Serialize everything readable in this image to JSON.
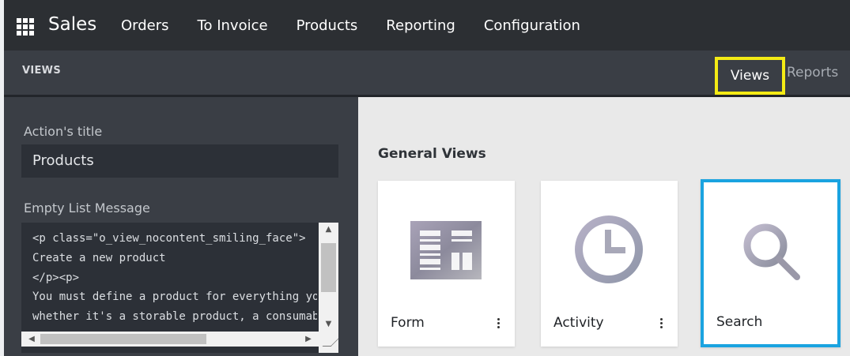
{
  "navbar": {
    "app_name": "Sales",
    "menu": [
      "Orders",
      "To Invoice",
      "Products",
      "Reporting",
      "Configuration"
    ]
  },
  "subbar": {
    "title": "VIEWS",
    "tabs": {
      "views": "Views",
      "reports": "Reports"
    }
  },
  "sidebar": {
    "action_title_label": "Action's title",
    "action_title_value": "Products",
    "empty_list_label": "Empty List Message",
    "empty_list_value": "<p class=\"o_view_nocontent_smiling_face\">\nCreate a new product\n</p><p>\nYou must define a product for everything you sell or purchase,\nwhether it's a storable product, a consumable or a service."
  },
  "main": {
    "section_title": "General Views",
    "cards": [
      {
        "name": "Form",
        "icon": "form-icon"
      },
      {
        "name": "Activity",
        "icon": "clock-icon"
      },
      {
        "name": "Search",
        "icon": "magnifier-icon"
      }
    ]
  },
  "colors": {
    "navbar_bg": "#2c2f33",
    "sidebar_bg": "#3a3e45",
    "highlight_yellow": "#f4eb15",
    "highlight_blue": "#1aa3e0"
  }
}
